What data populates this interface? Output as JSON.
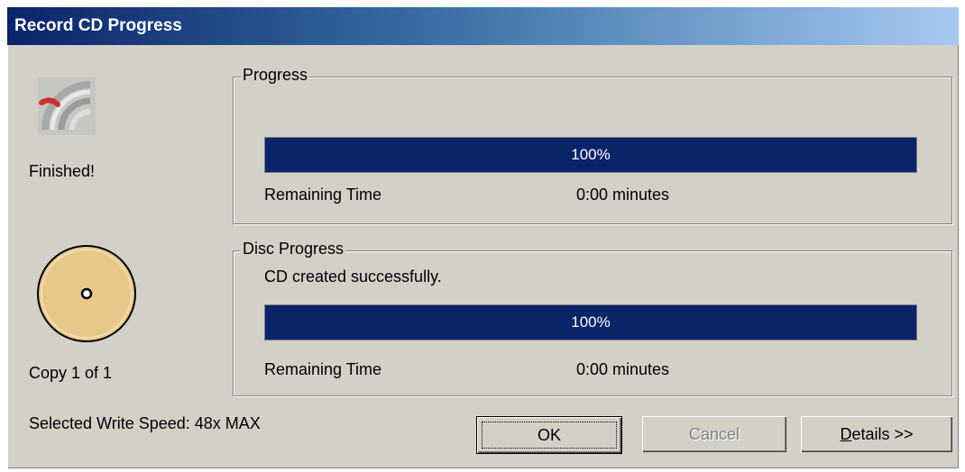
{
  "window": {
    "title": "Record CD Progress"
  },
  "status": {
    "state_label": "Finished!",
    "copy_label": "Copy 1 of 1",
    "write_speed_label": "Selected Write Speed: 48x MAX"
  },
  "progress_group": {
    "legend": "Progress",
    "percent": 100,
    "percent_text": "100%",
    "remaining_label": "Remaining Time",
    "remaining_value": "0:00 minutes"
  },
  "disc_group": {
    "legend": "Disc Progress",
    "message": "CD created successfully.",
    "percent": 100,
    "percent_text": "100%",
    "remaining_label": "Remaining Time",
    "remaining_value": "0:00 minutes"
  },
  "buttons": {
    "ok_label": "OK",
    "cancel_label": "Cancel",
    "details_accel": "D",
    "details_rest": "etails >>"
  },
  "colors": {
    "titlebar_start": "#0a246a",
    "titlebar_end": "#a6caf0",
    "progress_fill": "#0a246a",
    "dialog_face": "#d4d0c8",
    "disc_face": "#e8c78a"
  },
  "icons": {
    "status": "cd-burn-icon",
    "disc": "disc-icon"
  }
}
